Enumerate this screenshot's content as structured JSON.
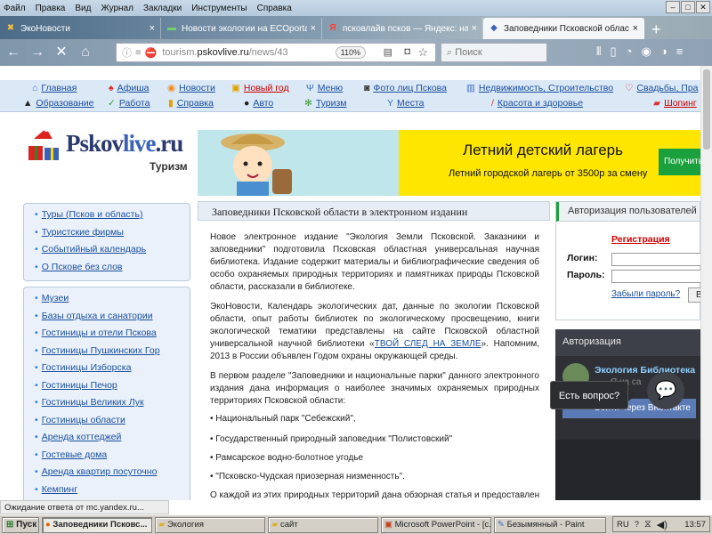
{
  "browser": {
    "menu": [
      "Файл",
      "Правка",
      "Вид",
      "Журнал",
      "Закладки",
      "Инструменты",
      "Справка"
    ],
    "tabs": [
      {
        "title": "ЭкоНовости",
        "icon": "ecology-tab-icon",
        "active": false
      },
      {
        "title": "Новости экологии на ECOportal",
        "icon": "ecoportal-tab-icon",
        "active": false
      },
      {
        "title": "псковлайв псков — Яндекс: на",
        "icon": "yandex-tab-icon",
        "active": false
      },
      {
        "title": "Заповедники Псковской облас",
        "icon": "pskovlive-tab-icon",
        "active": true
      }
    ],
    "url_prefix": "tourism.",
    "url_host": "pskovlive.ru",
    "url_path": "/news/43",
    "zoom": "110%",
    "search_placeholder": "Поиск",
    "status_text": "Ожидание ответа от mc.yandex.ru..."
  },
  "site": {
    "logo_main_1": "Pskov",
    "logo_main_2": "live",
    "logo_main_3": ".ru",
    "logo_sub": "Туризм",
    "topnav_row1": [
      "Главная",
      "Афиша",
      "Новости",
      "Новый год",
      "Меню",
      "Фото лиц Пскова",
      "Недвижимость, Строительство",
      "Свадьбы, Пра"
    ],
    "topnav_row2": [
      "Образование",
      "Работа",
      "Справка",
      "Авто",
      "Туризм",
      "Места",
      "Красота и здоровье",
      "Шопинг"
    ],
    "banner": {
      "title": "Летний детский лагерь",
      "subtitle": "Летний городской лагерь от 3500р за смену",
      "button": "Получить"
    },
    "sidebar1": [
      "Туры (Псков и область)",
      "Туристские фирмы",
      "Событийный календарь",
      "О Пскове без слов"
    ],
    "sidebar2": [
      "Музеи",
      "Базы отдыха и санатории",
      "Гостиницы и отели Пскова",
      "Гостиницы Пушкинских Гор",
      "Гостиницы Изборска",
      "Гостиницы Печор",
      "Гостиницы Великих Лук",
      "Гостиницы области",
      "Аренда коттеджей",
      "Гостевые дома",
      "Аренда квартир посуточно",
      "Кемпинг"
    ]
  },
  "article": {
    "title": "Заповедники Псковской области в электронном издании",
    "p1": "Новое электронное издание \"Экология Земли Псковской. Заказники и заповедники\" подготовила Псковская областная универсальная научная библиотека. Издание содержит материалы и библиографические сведения об особо охраняемых природных территориях и памятниках природы Псковской области, рассказали в библиотеке.",
    "p2_a": "ЭкоНовости, Календарь экологических дат, данные по экологии Псковской области, опыт работы библиотек по экологическому просвещению, книги экологической тематики представлены на сайте Псковской областной универсальной научной библиотеки «",
    "p2_link": "ТВОЙ СЛЕД НА ЗЕМЛЕ",
    "p2_b": "». Напомним, 2013 в России объявлен Годом охраны окружающей среды.",
    "p3": "В первом разделе \"Заповедники и национальные парки\" данного электронного издания дана информация о наиболее значимых охраняемых природных территориях Псковской области:",
    "b1": "• Национальный парк \"Себежский\",",
    "b2": "• Государственный природный заповедник \"Полистовский\"",
    "b3": "• Рамсарское водно-болотное угодье",
    "b4": "• \"Псковско-Чудская приозерная низменность\".",
    "p4": "О каждой из этих природных территорий дана обзорная статья и предоставлен"
  },
  "auth": {
    "title": "Авторизация пользователей",
    "register": "Регистрация",
    "login_label": "Логин:",
    "password_label": "Пароль:",
    "forgot": "Забыли пароль?",
    "go": "В",
    "dark_title": "Авторизация",
    "widget_name": "Экология Библиотека",
    "widget_sub": "Я на са",
    "vk_btn": "Войти через ВКонтакте",
    "ask": "Есть вопрос?"
  },
  "taskbar": {
    "start": "Пуск",
    "items": [
      {
        "label": "Заповедники Псковс...",
        "active": true,
        "w": 124
      },
      {
        "label": "Экология",
        "active": false,
        "w": 124
      },
      {
        "label": "сайт",
        "active": false,
        "w": 124
      },
      {
        "label": "Microsoft PowerPoint - [с...",
        "active": false,
        "w": 124
      },
      {
        "label": "Безымянный - Paint",
        "active": false,
        "w": 126
      }
    ],
    "lang": "RU",
    "clock": "13:57"
  },
  "colors": {
    "link": "#1a4f9e",
    "red": "#cc0000",
    "banner_yellow": "#ffe600",
    "green": "#1aa03c"
  }
}
